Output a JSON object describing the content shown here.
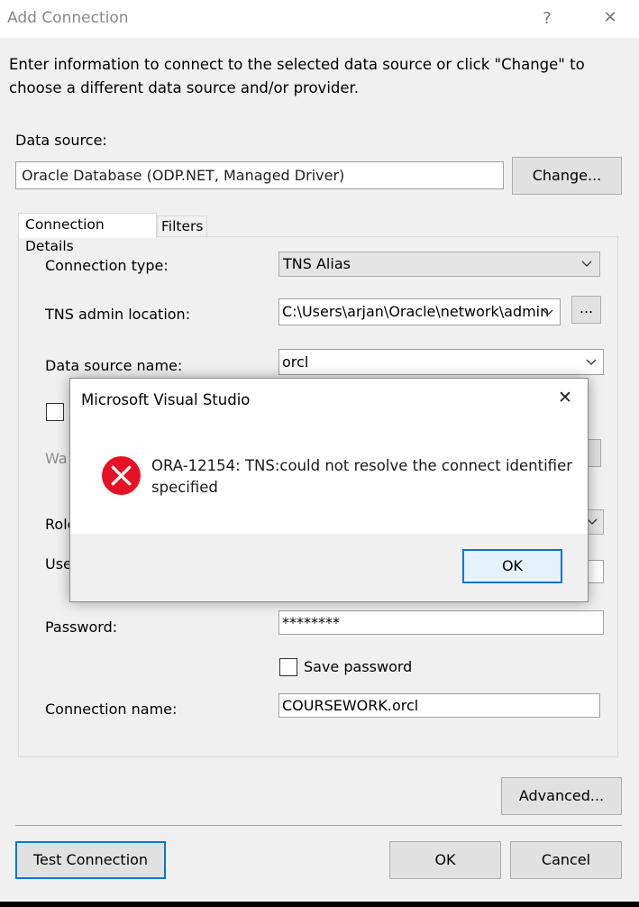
{
  "window": {
    "title": "Add Connection",
    "help_glyph": "?",
    "close_glyph": "✕"
  },
  "description": "Enter information to connect to the selected data source or click \"Change\" to choose a different data source and/or provider.",
  "data_source": {
    "label": "Data source:",
    "value": "Oracle Database (ODP.NET, Managed Driver)",
    "change_label": "Change..."
  },
  "tabs": [
    {
      "label": "Connection Details",
      "selected": true
    },
    {
      "label": "Filters",
      "selected": false
    }
  ],
  "form": {
    "connection_type_label": "Connection type:",
    "connection_type_value": "TNS Alias",
    "tns_admin_label": "TNS admin location:",
    "tns_admin_value": "C:\\Users\\arjan\\Oracle\\network\\admin",
    "browse_label": "...",
    "data_source_name_label": "Data source name:",
    "data_source_name_value": "orcl",
    "obscured_label_wa": "Wa",
    "obscured_label_role": "Role",
    "obscured_label_user": "Use",
    "password_label": "Password:",
    "password_value": "********",
    "save_password_label": "Save password",
    "connection_name_label": "Connection name:",
    "connection_name_value": "COURSEWORK.orcl"
  },
  "buttons": {
    "advanced": "Advanced...",
    "test_connection": "Test Connection",
    "ok": "OK",
    "cancel": "Cancel"
  },
  "message_box": {
    "title": "Microsoft Visual Studio",
    "close_glyph": "✕",
    "message": "ORA-12154: TNS:could not resolve the connect identifier specified",
    "ok_label": "OK",
    "icon": "error-icon",
    "icon_color": "#e81123"
  },
  "colors": {
    "accent": "#0078d7",
    "window_bg": "#f0f0f0"
  }
}
